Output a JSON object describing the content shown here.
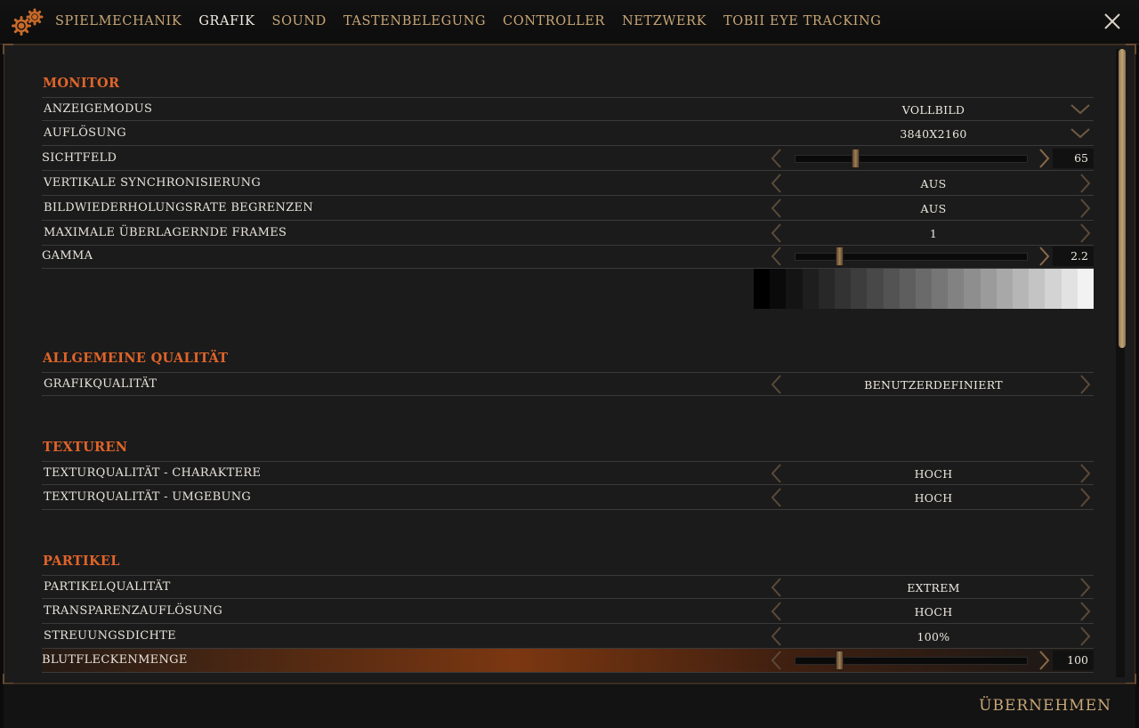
{
  "header": {
    "tabs": [
      {
        "label": "SPIELMECHANIK",
        "active": false
      },
      {
        "label": "GRAFIK",
        "active": true
      },
      {
        "label": "SOUND",
        "active": false
      },
      {
        "label": "TASTENBELEGUNG",
        "active": false
      },
      {
        "label": "CONTROLLER",
        "active": false
      },
      {
        "label": "NETZWERK",
        "active": false
      },
      {
        "label": "TOBII EYE TRACKING",
        "active": false
      }
    ]
  },
  "sections": {
    "monitor": {
      "title": "MONITOR",
      "anzeigemodus": {
        "label": "ANZEIGEMODUS",
        "value": "VOLLBILD"
      },
      "aufloesung": {
        "label": "AUFLÖSUNG",
        "value": "3840X2160"
      },
      "sichtfeld": {
        "label": "SICHTFELD",
        "value": "65",
        "fraction": 0.26
      },
      "vsync": {
        "label": "VERTIKALE SYNCHRONISIERUNG",
        "value": "AUS"
      },
      "framerate_limit": {
        "label": "BILDWIEDERHOLUNGSRATE BEGRENZEN",
        "value": "AUS"
      },
      "max_frames": {
        "label": "MAXIMALE ÜBERLAGERNDE FRAMES",
        "value": "1"
      },
      "gamma": {
        "label": "GAMMA",
        "value": "2.2",
        "fraction": 0.19
      }
    },
    "quality": {
      "title": "ALLGEMEINE QUALITÄT",
      "grafikqualitaet": {
        "label": "GRAFIKQUALITÄT",
        "value": "BENUTZERDEFINIERT"
      }
    },
    "textures": {
      "title": "TEXTUREN",
      "characters": {
        "label": "TEXTURQUALITÄT - CHARAKTERE",
        "value": "HOCH"
      },
      "environment": {
        "label": "TEXTURQUALITÄT - UMGEBUNG",
        "value": "HOCH"
      }
    },
    "particles": {
      "title": "PARTIKEL",
      "quality": {
        "label": "PARTIKELQUALITÄT",
        "value": "EXTREM"
      },
      "transparency": {
        "label": "TRANSPARENZAUFLÖSUNG",
        "value": "HOCH"
      },
      "scatter": {
        "label": "STREUUNGSDICHTE",
        "value": "100%"
      },
      "blood": {
        "label": "BLUTFLECKENMENGE",
        "value": "100",
        "fraction": 0.19
      }
    }
  },
  "footer": {
    "apply_label": "ÜBERNEHMEN"
  },
  "colors": {
    "accent": "#e0642a",
    "gold": "#c8a676"
  },
  "gamma_steps": [
    "#000000",
    "#0a0a0a",
    "#141414",
    "#1e1e1e",
    "#282828",
    "#333333",
    "#3d3d3d",
    "#484848",
    "#535353",
    "#5e5e5e",
    "#6a6a6a",
    "#767676",
    "#828282",
    "#8e8e8e",
    "#9b9b9b",
    "#a8a8a8",
    "#b6b6b6",
    "#c4c4c4",
    "#d3d3d3",
    "#e2e2e2",
    "#f2f2f2"
  ]
}
